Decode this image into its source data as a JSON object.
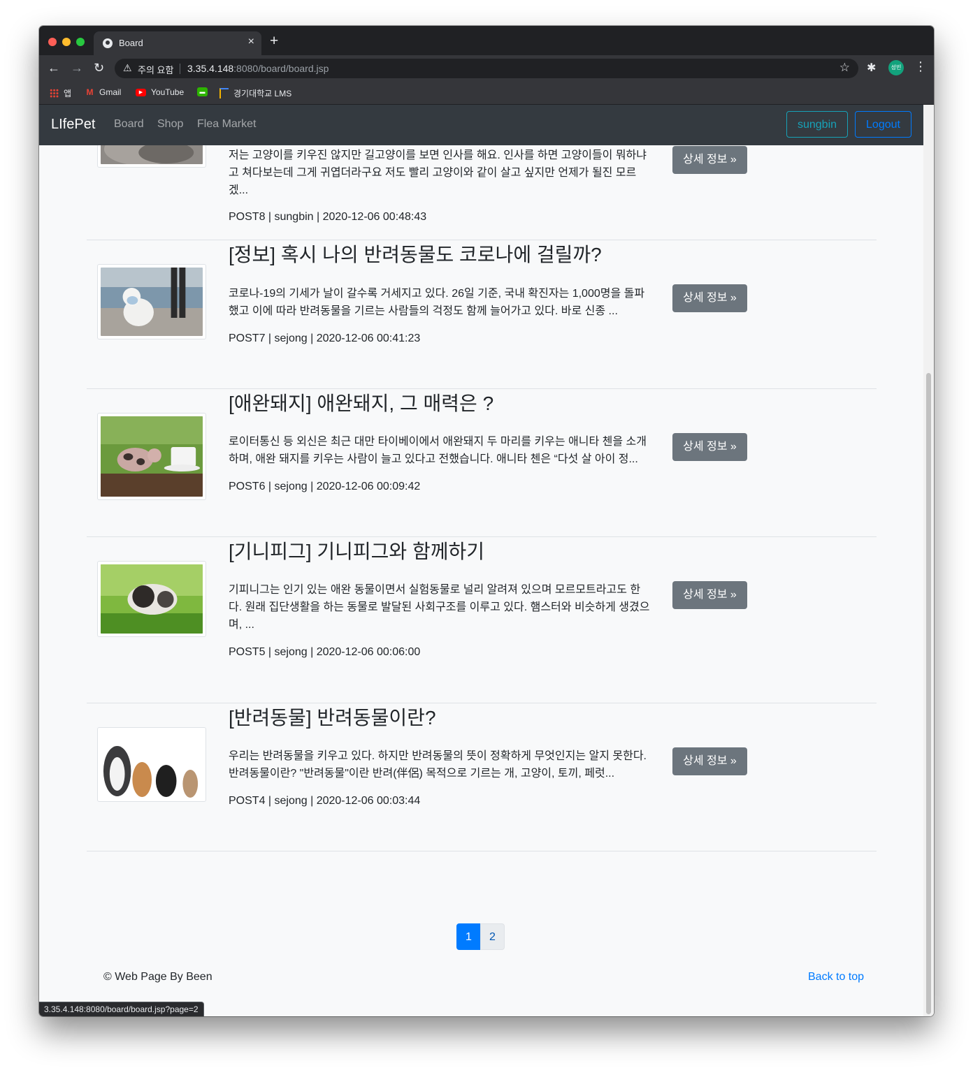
{
  "browser": {
    "tab_title": "Board",
    "security_label": "주의 요함",
    "url_host": "3.35.4.148",
    "url_rest": ":8080/board/board.jsp",
    "profile_initials": "성빈",
    "bookmarks": [
      {
        "label": "앱",
        "icon": "apps-grid-icon"
      },
      {
        "label": "Gmail",
        "icon": "gmail-icon"
      },
      {
        "label": "YouTube",
        "icon": "youtube-icon"
      },
      {
        "label": "",
        "icon": "message-icon"
      },
      {
        "label": "경기대학교 LMS",
        "icon": "lms-icon"
      }
    ],
    "status_url": "3.35.4.148:8080/board/board.jsp?page=2"
  },
  "nav": {
    "brand": "LIfePet",
    "links": [
      "Board",
      "Shop",
      "Flea Market"
    ],
    "user_button": "sungbin",
    "logout_button": "Logout"
  },
  "posts": [
    {
      "title": "",
      "body": "저는 고양이를 키우진 않지만 길고양이를 보면 인사를 해요. 인사를 하면 고양이들이 뭐하냐고 쳐다보는데 그게 귀엽더라구요 저도 빨리 고양이와 같이 살고 싶지만 언제가 될진 모르겠...",
      "meta": "POST8 | sungbin | 2020-12-06 00:48:43",
      "button": "상세 정보 »",
      "image": "cat-photo"
    },
    {
      "title": "[정보] 혹시 나의 반려동물도 코로나에 걸릴까?",
      "body": "코로나-19의 기세가 날이 갈수록 거세지고 있다. 26일 기준, 국내 확진자는 1,000명을 돌파했고 이에 따라 반려동물을 기르는 사람들의 걱정도 함께 늘어가고 있다. 바로 신종 ...",
      "meta": "POST7 | sejong | 2020-12-06 00:41:23",
      "button": "상세 정보 »",
      "image": "masked-dog-photo"
    },
    {
      "title": "[애완돼지] 애완돼지, 그 매력은 ?",
      "body": "로이터통신 등 외신은 최근 대만 타이베이에서 애완돼지 두 마리를 키우는 애니타 첸을 소개하며, 애완 돼지를 키우는 사람이 늘고 있다고 전했습니다. 애니타 첸은 “다섯 살 아이 정...",
      "meta": "POST6 | sejong | 2020-12-06 00:09:42",
      "button": "상세 정보 »",
      "image": "piglet-photo"
    },
    {
      "title": "[기니피그] 기니피그와 함께하기",
      "body": "기피니그는 인기 있는 애완 동물이면서 실험동물로 널리 알려져 있으며 모르모트라고도 한다. 원래 집단생활을 하는 동물로 발달된 사회구조를 이루고 있다. 햄스터와 비슷하게 생겼으며, ...",
      "meta": "POST5 | sejong | 2020-12-06 00:06:00",
      "button": "상세 정보 »",
      "image": "guinea-pig-photo"
    },
    {
      "title": "[반려동물] 반려동물이란?",
      "body": "우리는 반려동물을 키우고 있다. 하지만 반려동물의 뜻이 정확하게 무엇인지는 알지 못한다. 반려동물이란? \"반려동물\"이란 반려(伴侶) 목적으로 기르는 개, 고양이, 토끼, 페럿...",
      "meta": "POST4 | sejong | 2020-12-06 00:03:44",
      "button": "상세 정보 »",
      "image": "pets-group-photo"
    }
  ],
  "pagination": {
    "pages": [
      "1",
      "2"
    ],
    "current": "1"
  },
  "footer": {
    "copyright": "© Web Page By Been",
    "back_to_top": "Back to top"
  },
  "colors": {
    "navbar": "#343a40",
    "primary": "#007bff",
    "info": "#17a2b8",
    "secondary": "#6c757d"
  }
}
